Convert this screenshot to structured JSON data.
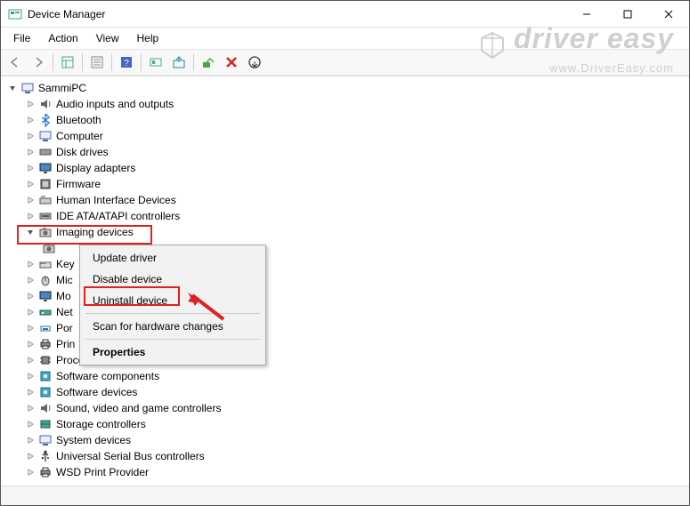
{
  "window": {
    "title": "Device Manager"
  },
  "menu": {
    "file": "File",
    "action": "Action",
    "view": "View",
    "help": "Help"
  },
  "tree": {
    "root": "SammiPC",
    "items": [
      "Audio inputs and outputs",
      "Bluetooth",
      "Computer",
      "Disk drives",
      "Display adapters",
      "Firmware",
      "Human Interface Devices",
      "IDE ATA/ATAPI controllers",
      "Imaging devices",
      "Key",
      "Mic",
      "Mo",
      "Net",
      "Por",
      "Prin",
      "Processors",
      "Software components",
      "Software devices",
      "Sound, video and game controllers",
      "Storage controllers",
      "System devices",
      "Universal Serial Bus controllers",
      "WSD Print Provider"
    ]
  },
  "context_menu": {
    "update": "Update driver",
    "disable": "Disable device",
    "uninstall": "Uninstall device",
    "scan": "Scan for hardware changes",
    "properties": "Properties"
  },
  "watermark": {
    "brand": "driver easy",
    "url": "www.DriverEasy.com"
  }
}
